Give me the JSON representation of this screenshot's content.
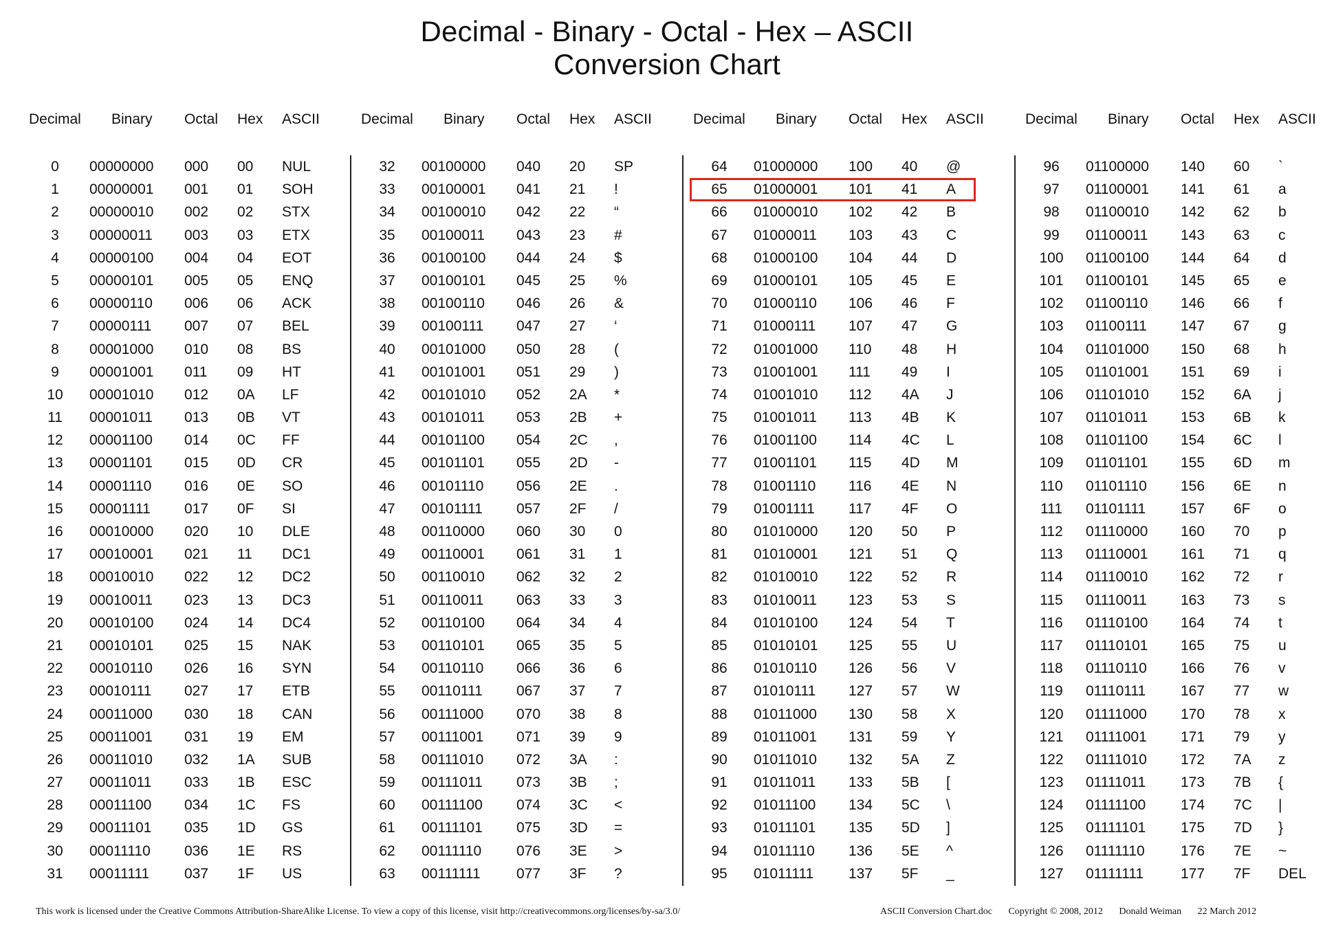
{
  "title": {
    "line1": "Decimal - Binary - Octal - Hex – ASCII",
    "line2": "Conversion Chart"
  },
  "headers": {
    "decimal": "Decimal",
    "binary": "Binary",
    "octal": "Octal",
    "hex": "Hex",
    "ascii": "ASCII"
  },
  "highlight": {
    "decimal": "65",
    "color": "#e0241b"
  },
  "groups": [
    {
      "rows": [
        [
          "0",
          "00000000",
          "000",
          "00",
          "NUL"
        ],
        [
          "1",
          "00000001",
          "001",
          "01",
          "SOH"
        ],
        [
          "2",
          "00000010",
          "002",
          "02",
          "STX"
        ],
        [
          "3",
          "00000011",
          "003",
          "03",
          "ETX"
        ],
        [
          "4",
          "00000100",
          "004",
          "04",
          "EOT"
        ],
        [
          "5",
          "00000101",
          "005",
          "05",
          "ENQ"
        ],
        [
          "6",
          "00000110",
          "006",
          "06",
          "ACK"
        ],
        [
          "7",
          "00000111",
          "007",
          "07",
          "BEL"
        ],
        [
          "8",
          "00001000",
          "010",
          "08",
          "BS"
        ],
        [
          "9",
          "00001001",
          "011",
          "09",
          "HT"
        ],
        [
          "10",
          "00001010",
          "012",
          "0A",
          "LF"
        ],
        [
          "11",
          "00001011",
          "013",
          "0B",
          "VT"
        ],
        [
          "12",
          "00001100",
          "014",
          "0C",
          "FF"
        ],
        [
          "13",
          "00001101",
          "015",
          "0D",
          "CR"
        ],
        [
          "14",
          "00001110",
          "016",
          "0E",
          "SO"
        ],
        [
          "15",
          "00001111",
          "017",
          "0F",
          "SI"
        ],
        [
          "16",
          "00010000",
          "020",
          "10",
          "DLE"
        ],
        [
          "17",
          "00010001",
          "021",
          "11",
          "DC1"
        ],
        [
          "18",
          "00010010",
          "022",
          "12",
          "DC2"
        ],
        [
          "19",
          "00010011",
          "023",
          "13",
          "DC3"
        ],
        [
          "20",
          "00010100",
          "024",
          "14",
          "DC4"
        ],
        [
          "21",
          "00010101",
          "025",
          "15",
          "NAK"
        ],
        [
          "22",
          "00010110",
          "026",
          "16",
          "SYN"
        ],
        [
          "23",
          "00010111",
          "027",
          "17",
          "ETB"
        ],
        [
          "24",
          "00011000",
          "030",
          "18",
          "CAN"
        ],
        [
          "25",
          "00011001",
          "031",
          "19",
          "EM"
        ],
        [
          "26",
          "00011010",
          "032",
          "1A",
          "SUB"
        ],
        [
          "27",
          "00011011",
          "033",
          "1B",
          "ESC"
        ],
        [
          "28",
          "00011100",
          "034",
          "1C",
          "FS"
        ],
        [
          "29",
          "00011101",
          "035",
          "1D",
          "GS"
        ],
        [
          "30",
          "00011110",
          "036",
          "1E",
          "RS"
        ],
        [
          "31",
          "00011111",
          "037",
          "1F",
          "US"
        ]
      ]
    },
    {
      "rows": [
        [
          "32",
          "00100000",
          "040",
          "20",
          "SP"
        ],
        [
          "33",
          "00100001",
          "041",
          "21",
          "!"
        ],
        [
          "34",
          "00100010",
          "042",
          "22",
          "“"
        ],
        [
          "35",
          "00100011",
          "043",
          "23",
          "#"
        ],
        [
          "36",
          "00100100",
          "044",
          "24",
          "$"
        ],
        [
          "37",
          "00100101",
          "045",
          "25",
          "%"
        ],
        [
          "38",
          "00100110",
          "046",
          "26",
          "&"
        ],
        [
          "39",
          "00100111",
          "047",
          "27",
          "‘"
        ],
        [
          "40",
          "00101000",
          "050",
          "28",
          "("
        ],
        [
          "41",
          "00101001",
          "051",
          "29",
          ")"
        ],
        [
          "42",
          "00101010",
          "052",
          "2A",
          "*"
        ],
        [
          "43",
          "00101011",
          "053",
          "2B",
          "+"
        ],
        [
          "44",
          "00101100",
          "054",
          "2C",
          ","
        ],
        [
          "45",
          "00101101",
          "055",
          "2D",
          "-"
        ],
        [
          "46",
          "00101110",
          "056",
          "2E",
          "."
        ],
        [
          "47",
          "00101111",
          "057",
          "2F",
          "/"
        ],
        [
          "48",
          "00110000",
          "060",
          "30",
          "0"
        ],
        [
          "49",
          "00110001",
          "061",
          "31",
          "1"
        ],
        [
          "50",
          "00110010",
          "062",
          "32",
          "2"
        ],
        [
          "51",
          "00110011",
          "063",
          "33",
          "3"
        ],
        [
          "52",
          "00110100",
          "064",
          "34",
          "4"
        ],
        [
          "53",
          "00110101",
          "065",
          "35",
          "5"
        ],
        [
          "54",
          "00110110",
          "066",
          "36",
          "6"
        ],
        [
          "55",
          "00110111",
          "067",
          "37",
          "7"
        ],
        [
          "56",
          "00111000",
          "070",
          "38",
          "8"
        ],
        [
          "57",
          "00111001",
          "071",
          "39",
          "9"
        ],
        [
          "58",
          "00111010",
          "072",
          "3A",
          ":"
        ],
        [
          "59",
          "00111011",
          "073",
          "3B",
          ";"
        ],
        [
          "60",
          "00111100",
          "074",
          "3C",
          "<"
        ],
        [
          "61",
          "00111101",
          "075",
          "3D",
          "="
        ],
        [
          "62",
          "00111110",
          "076",
          "3E",
          ">"
        ],
        [
          "63",
          "00111111",
          "077",
          "3F",
          "?"
        ]
      ]
    },
    {
      "rows": [
        [
          "64",
          "01000000",
          "100",
          "40",
          "@"
        ],
        [
          "65",
          "01000001",
          "101",
          "41",
          "A"
        ],
        [
          "66",
          "01000010",
          "102",
          "42",
          "B"
        ],
        [
          "67",
          "01000011",
          "103",
          "43",
          "C"
        ],
        [
          "68",
          "01000100",
          "104",
          "44",
          "D"
        ],
        [
          "69",
          "01000101",
          "105",
          "45",
          "E"
        ],
        [
          "70",
          "01000110",
          "106",
          "46",
          "F"
        ],
        [
          "71",
          "01000111",
          "107",
          "47",
          "G"
        ],
        [
          "72",
          "01001000",
          "110",
          "48",
          "H"
        ],
        [
          "73",
          "01001001",
          "111",
          "49",
          "I"
        ],
        [
          "74",
          "01001010",
          "112",
          "4A",
          "J"
        ],
        [
          "75",
          "01001011",
          "113",
          "4B",
          "K"
        ],
        [
          "76",
          "01001100",
          "114",
          "4C",
          "L"
        ],
        [
          "77",
          "01001101",
          "115",
          "4D",
          "M"
        ],
        [
          "78",
          "01001110",
          "116",
          "4E",
          "N"
        ],
        [
          "79",
          "01001111",
          "117",
          "4F",
          "O"
        ],
        [
          "80",
          "01010000",
          "120",
          "50",
          "P"
        ],
        [
          "81",
          "01010001",
          "121",
          "51",
          "Q"
        ],
        [
          "82",
          "01010010",
          "122",
          "52",
          "R"
        ],
        [
          "83",
          "01010011",
          "123",
          "53",
          "S"
        ],
        [
          "84",
          "01010100",
          "124",
          "54",
          "T"
        ],
        [
          "85",
          "01010101",
          "125",
          "55",
          "U"
        ],
        [
          "86",
          "01010110",
          "126",
          "56",
          "V"
        ],
        [
          "87",
          "01010111",
          "127",
          "57",
          "W"
        ],
        [
          "88",
          "01011000",
          "130",
          "58",
          "X"
        ],
        [
          "89",
          "01011001",
          "131",
          "59",
          "Y"
        ],
        [
          "90",
          "01011010",
          "132",
          "5A",
          "Z"
        ],
        [
          "91",
          "01011011",
          "133",
          "5B",
          "["
        ],
        [
          "92",
          "01011100",
          "134",
          "5C",
          "\\"
        ],
        [
          "93",
          "01011101",
          "135",
          "5D",
          "]"
        ],
        [
          "94",
          "01011110",
          "136",
          "5E",
          "^"
        ],
        [
          "95",
          "01011111",
          "137",
          "5F",
          "_"
        ]
      ]
    },
    {
      "rows": [
        [
          "96",
          "01100000",
          "140",
          "60",
          "`"
        ],
        [
          "97",
          "01100001",
          "141",
          "61",
          "a"
        ],
        [
          "98",
          "01100010",
          "142",
          "62",
          "b"
        ],
        [
          "99",
          "01100011",
          "143",
          "63",
          "c"
        ],
        [
          "100",
          "01100100",
          "144",
          "64",
          "d"
        ],
        [
          "101",
          "01100101",
          "145",
          "65",
          "e"
        ],
        [
          "102",
          "01100110",
          "146",
          "66",
          "f"
        ],
        [
          "103",
          "01100111",
          "147",
          "67",
          "g"
        ],
        [
          "104",
          "01101000",
          "150",
          "68",
          "h"
        ],
        [
          "105",
          "01101001",
          "151",
          "69",
          "i"
        ],
        [
          "106",
          "01101010",
          "152",
          "6A",
          "j"
        ],
        [
          "107",
          "01101011",
          "153",
          "6B",
          "k"
        ],
        [
          "108",
          "01101100",
          "154",
          "6C",
          "l"
        ],
        [
          "109",
          "01101101",
          "155",
          "6D",
          "m"
        ],
        [
          "110",
          "01101110",
          "156",
          "6E",
          "n"
        ],
        [
          "111",
          "01101111",
          "157",
          "6F",
          "o"
        ],
        [
          "112",
          "01110000",
          "160",
          "70",
          "p"
        ],
        [
          "113",
          "01110001",
          "161",
          "71",
          "q"
        ],
        [
          "114",
          "01110010",
          "162",
          "72",
          "r"
        ],
        [
          "115",
          "01110011",
          "163",
          "73",
          "s"
        ],
        [
          "116",
          "01110100",
          "164",
          "74",
          "t"
        ],
        [
          "117",
          "01110101",
          "165",
          "75",
          "u"
        ],
        [
          "118",
          "01110110",
          "166",
          "76",
          "v"
        ],
        [
          "119",
          "01110111",
          "167",
          "77",
          "w"
        ],
        [
          "120",
          "01111000",
          "170",
          "78",
          "x"
        ],
        [
          "121",
          "01111001",
          "171",
          "79",
          "y"
        ],
        [
          "122",
          "01111010",
          "172",
          "7A",
          "z"
        ],
        [
          "123",
          "01111011",
          "173",
          "7B",
          "{"
        ],
        [
          "124",
          "01111100",
          "174",
          "7C",
          "|"
        ],
        [
          "125",
          "01111101",
          "175",
          "7D",
          "}"
        ],
        [
          "126",
          "01111110",
          "176",
          "7E",
          "~"
        ],
        [
          "127",
          "01111111",
          "177",
          "7F",
          "DEL"
        ]
      ]
    }
  ],
  "footer": {
    "license": "This work is licensed under the Creative Commons Attribution-ShareAlike License.  To view a copy of this license, visit  http://creativecommons.org/licenses/by-sa/3.0/",
    "filename": "ASCII Conversion Chart.doc",
    "copyright": "Copyright © 2008, 2012",
    "author": "Donald Weiman",
    "date": "22 March 2012"
  }
}
